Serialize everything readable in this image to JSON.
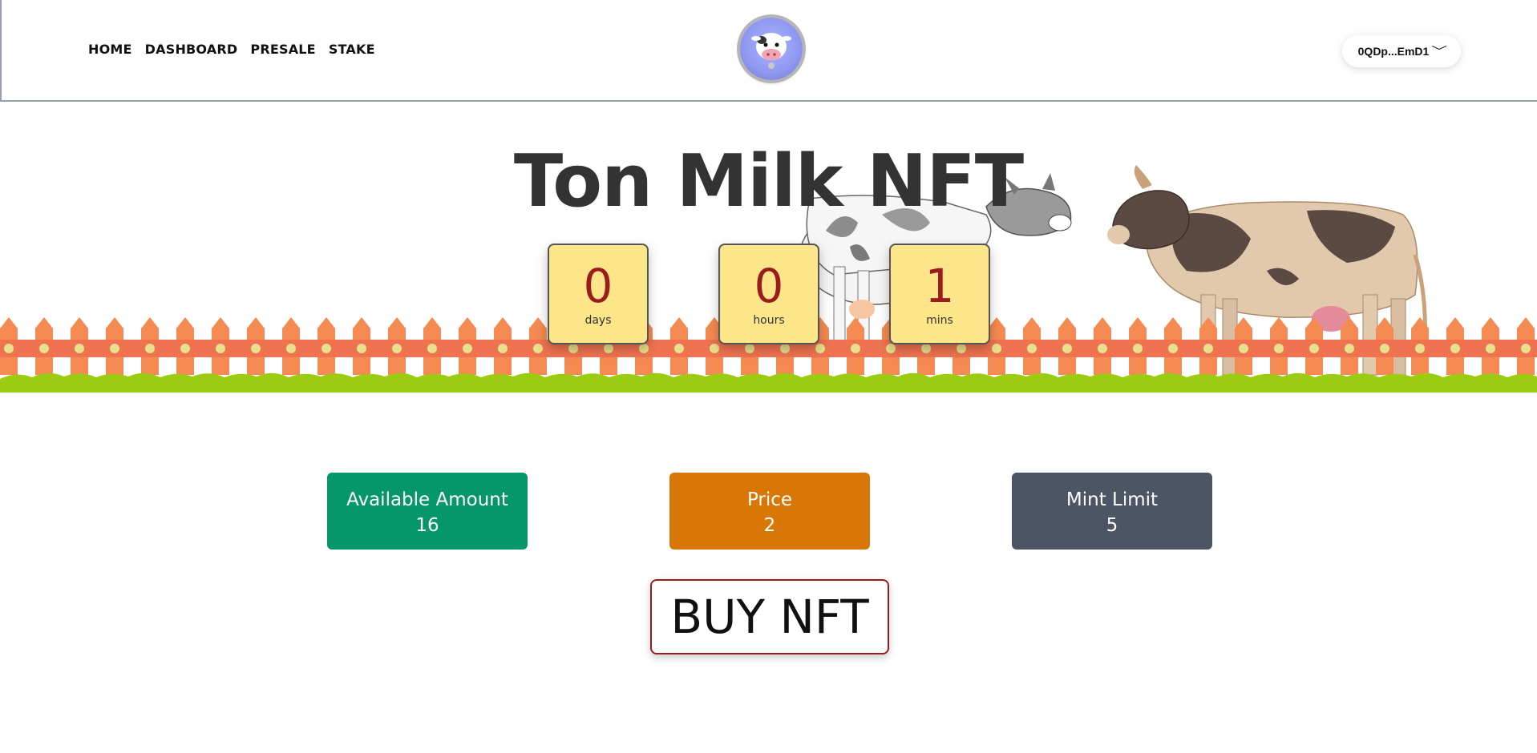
{
  "nav": {
    "items": [
      {
        "label": "HOME"
      },
      {
        "label": "DASHBOARD"
      },
      {
        "label": "PRESALE"
      },
      {
        "label": "STAKE"
      }
    ]
  },
  "logo": {
    "icon": "cow-logo-icon"
  },
  "wallet": {
    "address": "0QDp...EmD1",
    "icon": "chevron-down-icon"
  },
  "hero": {
    "title": "Ton Milk NFT",
    "countdown": [
      {
        "value": "0",
        "unit": "days"
      },
      {
        "value": "0",
        "unit": "hours"
      },
      {
        "value": "1",
        "unit": "mins"
      }
    ]
  },
  "stats": [
    {
      "label": "Available Amount",
      "value": "16",
      "color": "#059669"
    },
    {
      "label": "Price",
      "value": "2",
      "color": "#d97706"
    },
    {
      "label": "Mint Limit",
      "value": "5",
      "color": "#4b5563"
    }
  ],
  "buy_button": {
    "label": "BUY NFT"
  },
  "colors": {
    "fence": "#f58a52",
    "fence_rail": "#ef7350",
    "grass": "#9ccc12",
    "countdown_bg": "#fde68a",
    "countdown_text": "#9b1c1c"
  }
}
